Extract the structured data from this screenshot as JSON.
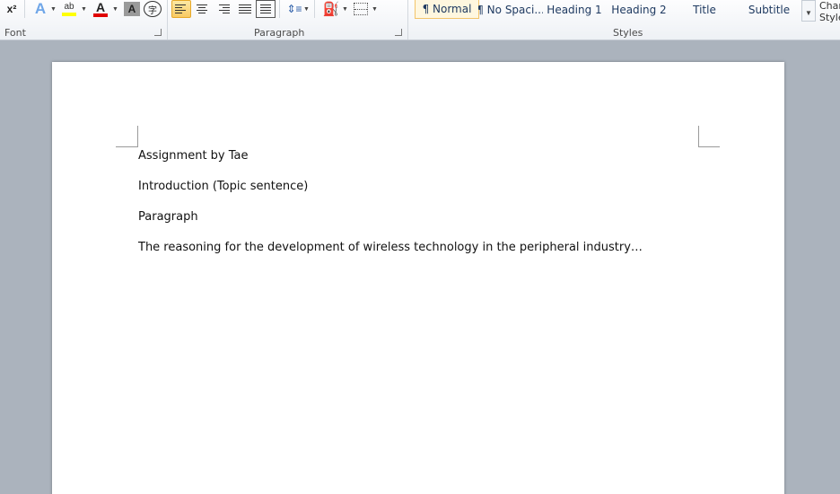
{
  "ribbon": {
    "groups": {
      "font": "Font",
      "paragraph": "Paragraph",
      "styles": "Styles"
    },
    "font_buttons": {
      "superscript_glyph": "x²",
      "text_effects_glyph": "A",
      "highlight_glyph": "ab",
      "font_color_glyph": "A",
      "char_shading_glyph": "A",
      "enclose_glyph": "字"
    },
    "highlight_color": "#ffff00",
    "font_color": "#e00000",
    "styles_gallery": [
      {
        "label": "¶ Normal",
        "active": true
      },
      {
        "label": "¶ No Spaci...",
        "active": false
      },
      {
        "label": "Heading 1",
        "active": false
      },
      {
        "label": "Heading 2",
        "active": false
      },
      {
        "label": "Title",
        "active": false
      },
      {
        "label": "Subtitle",
        "active": false
      }
    ],
    "change_styles": {
      "line1": "Chan",
      "line2": "Style"
    }
  },
  "document": {
    "paragraphs": [
      "Assignment by Tae",
      "Introduction (Topic sentence)",
      "Paragraph",
      "The reasoning for the development of wireless technology in the peripheral industry…"
    ]
  }
}
